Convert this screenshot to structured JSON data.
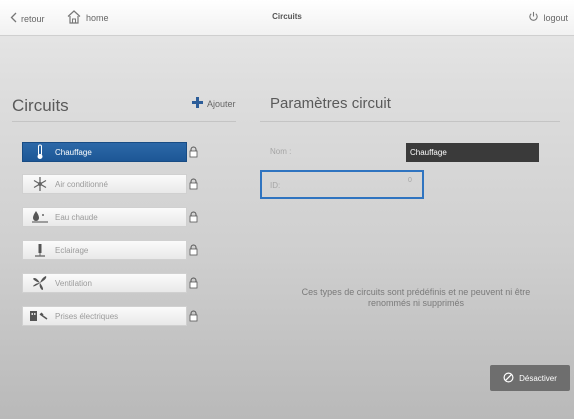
{
  "topbar": {
    "back_label": "retour",
    "home_label": "home",
    "title": "Circuits",
    "logout_label": "logout"
  },
  "left": {
    "title": "Circuits",
    "add_label": "Ajouter",
    "items": [
      {
        "label": "Chauffage",
        "icon": "thermometer-icon",
        "active": true
      },
      {
        "label": "Air conditionné",
        "icon": "snowflake-icon",
        "active": false
      },
      {
        "label": "Eau chaude",
        "icon": "hot-water-icon",
        "active": false
      },
      {
        "label": "Eclairage",
        "icon": "lamp-icon",
        "active": false
      },
      {
        "label": "Ventilation",
        "icon": "fan-icon",
        "active": false
      },
      {
        "label": "Prises électriques",
        "icon": "plug-icon",
        "active": false
      }
    ]
  },
  "right": {
    "title": "Paramètres circuit",
    "name_label": "Nom :",
    "name_value": "Chauffage",
    "id_label": "ID:",
    "id_value": "0",
    "info_text": "Ces types de circuits sont prédéfinis et ne peuvent ni être renommés ni supprimés",
    "deactivate_label": "Désactiver"
  },
  "colors": {
    "accent": "#2c68a8",
    "focus_border": "#2f74c0",
    "button": "#6e6e6e"
  }
}
